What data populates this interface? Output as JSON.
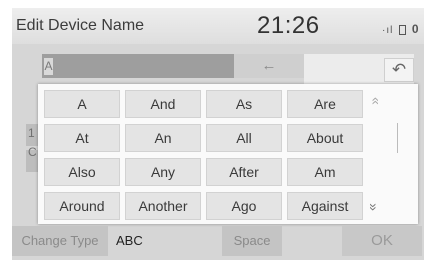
{
  "header": {
    "title": "Edit Device Name",
    "clock": "21:26",
    "status_text": "·ıl",
    "status_battery": "0"
  },
  "input": {
    "value": "A",
    "backspace_glyph": "←"
  },
  "back_glyph": "↶",
  "background_partial": [
    "1",
    "C"
  ],
  "predictions": [
    "A",
    "And",
    "As",
    "Are",
    "At",
    "An",
    "All",
    "About",
    "Also",
    "Any",
    "After",
    "Am",
    "Around",
    "Another",
    "Ago",
    "Against"
  ],
  "scroll": {
    "up_glyph": "»",
    "down_glyph": "»"
  },
  "bottom": {
    "change_type": "Change Type",
    "mode": "ABC",
    "space": "Space",
    "ok": "OK"
  }
}
